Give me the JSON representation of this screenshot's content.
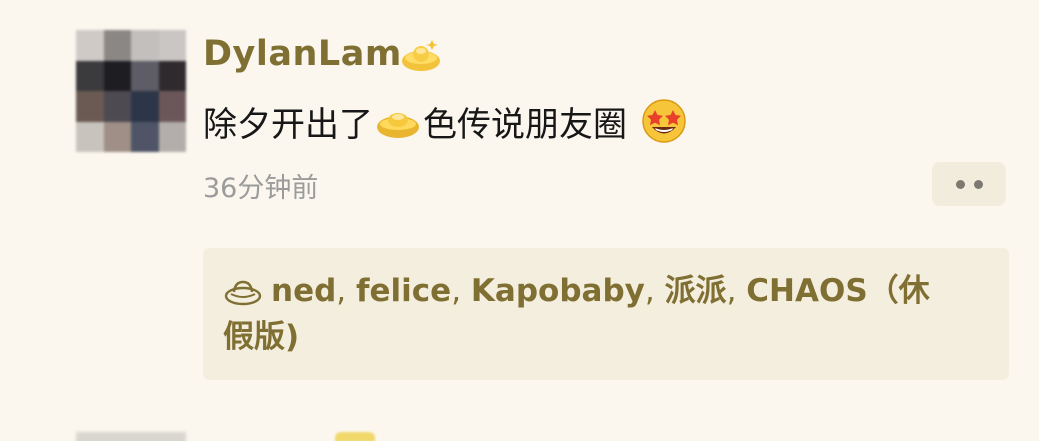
{
  "post": {
    "username": "DylanLam",
    "content_before": "除夕开出了",
    "content_after": "色传说朋友圈",
    "time": "36分钟前"
  },
  "likes": {
    "names": [
      "ned",
      "felice",
      "Kapobaby",
      "派派",
      "CHAOS（休"
    ],
    "separator": ", ",
    "wrap_text": "假版)"
  },
  "icons": {
    "name_badge": "gold-ingot-icon",
    "inline_emoji": "gold-ingot-icon",
    "reaction_emoji": "star-struck-emoji-icon",
    "likes_icon": "ingot-outline-icon",
    "more": "more-dots-icon"
  },
  "colors": {
    "username": "#7f6f32",
    "background": "#fbf7ee",
    "likes_background": "#f4eede",
    "time": "#9b9b9b"
  },
  "avatar_pixels": [
    "#cfcac6",
    "#8a8784",
    "#c2bfbd",
    "#c9c6c4",
    "#3b3a3d",
    "#1e1d22",
    "#5e5c66",
    "#2f2a2e",
    "#6a5a53",
    "#4d4a52",
    "#2d3648",
    "#6b575a",
    "#c9c3bd",
    "#9f8f86",
    "#4f5566",
    "#b3aeab"
  ]
}
